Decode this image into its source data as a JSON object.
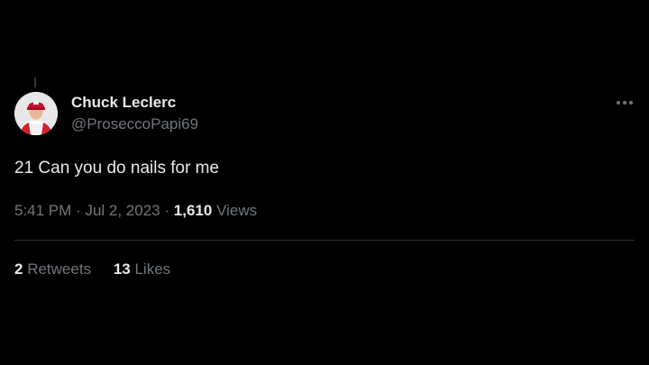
{
  "author": {
    "display_name": "Chuck Leclerc",
    "handle": "@ProseccoPapi69"
  },
  "more_icon": "more-horizontal-icon",
  "tweet": {
    "text": "21 Can you do nails for me"
  },
  "meta": {
    "time": "5:41 PM",
    "separator": "·",
    "date": "Jul 2, 2023",
    "views_count": "1,610",
    "views_label": "Views"
  },
  "stats": {
    "retweets_count": "2",
    "retweets_label": "Retweets",
    "likes_count": "13",
    "likes_label": "Likes"
  },
  "colors": {
    "background": "#000000",
    "primary_text": "#e7e9ea",
    "secondary_text": "#71767b",
    "divider": "#2f3336"
  }
}
